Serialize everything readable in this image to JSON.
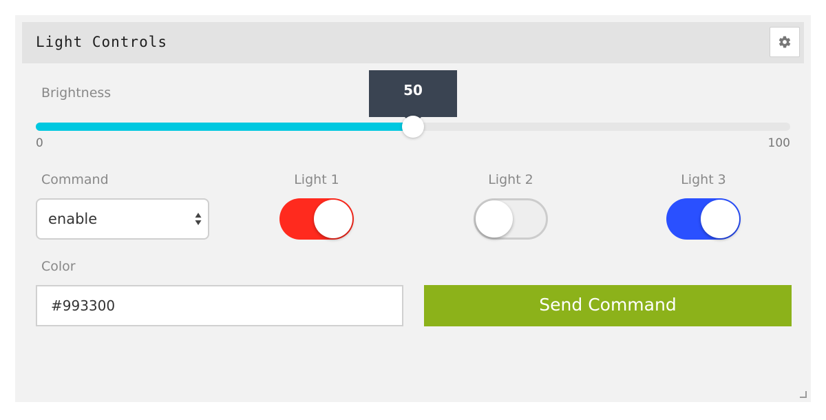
{
  "panel": {
    "title": "Light Controls",
    "settings_icon": "gear-icon"
  },
  "brightness": {
    "label": "Brightness",
    "value": 50,
    "min": 0,
    "max": 100,
    "value_text": "50",
    "min_text": "0",
    "max_text": "100",
    "fill_color": "#00c8e0",
    "tooltip_color": "#3a4452"
  },
  "command": {
    "label": "Command",
    "selected": "enable"
  },
  "lights": [
    {
      "label": "Light 1",
      "on": true,
      "color": "#ff2a1e"
    },
    {
      "label": "Light 2",
      "on": false,
      "color": "#cccccc"
    },
    {
      "label": "Light 3",
      "on": true,
      "color": "#2a50ff"
    }
  ],
  "color": {
    "label": "Color",
    "value": "#993300"
  },
  "send_button": {
    "label": "Send Command",
    "color": "#8cb21a"
  }
}
